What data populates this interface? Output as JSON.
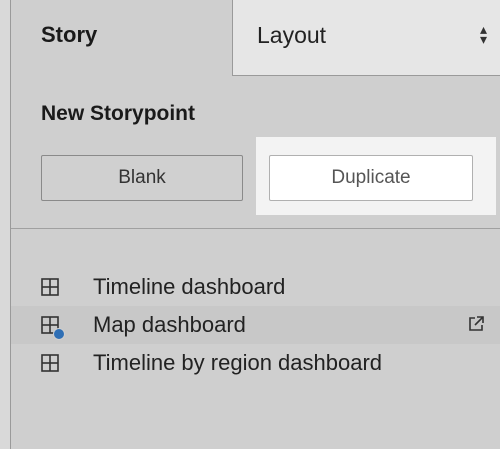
{
  "tabs": {
    "story_label": "Story",
    "layout_label": "Layout",
    "layout_arrows_icon": "updown-arrows-icon"
  },
  "new_storypoint": {
    "title": "New Storypoint",
    "blank_label": "Blank",
    "duplicate_label": "Duplicate"
  },
  "sheets": [
    {
      "label": "Timeline dashboard",
      "icon": "dashboard-grid-icon",
      "selected": false
    },
    {
      "label": "Map dashboard",
      "icon": "dashboard-grid-in-use-icon",
      "selected": true,
      "action_icon": "open-external-icon"
    },
    {
      "label": "Timeline by region dashboard",
      "icon": "dashboard-grid-icon",
      "selected": false
    }
  ],
  "colors": {
    "panel_bg": "#cfcfcf",
    "highlight": "#f3f3f3",
    "badge": "#2f6fb5"
  }
}
